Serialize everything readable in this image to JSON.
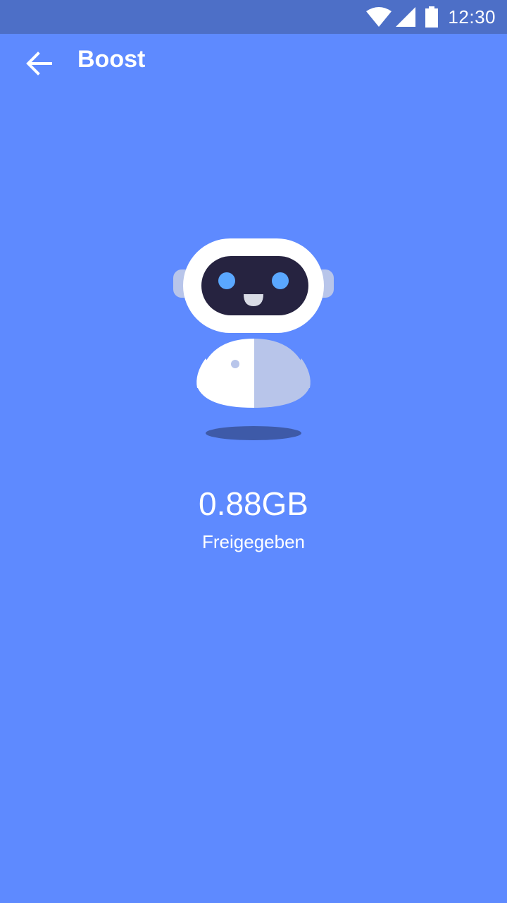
{
  "status_bar": {
    "time": "12:30",
    "icons": [
      "wifi-icon",
      "cell-signal-icon",
      "battery-icon"
    ]
  },
  "app_bar": {
    "title": "Boost",
    "back_icon": "arrow-back-icon"
  },
  "result": {
    "amount": "0.88GB",
    "label": "Freigegeben"
  },
  "illustration": "robot-mascot",
  "colors": {
    "background": "#5e8aff",
    "status_bar": "#4d6fc7",
    "robot_face": "#262340",
    "robot_eyes": "#5aa7ff",
    "text": "#ffffff"
  }
}
